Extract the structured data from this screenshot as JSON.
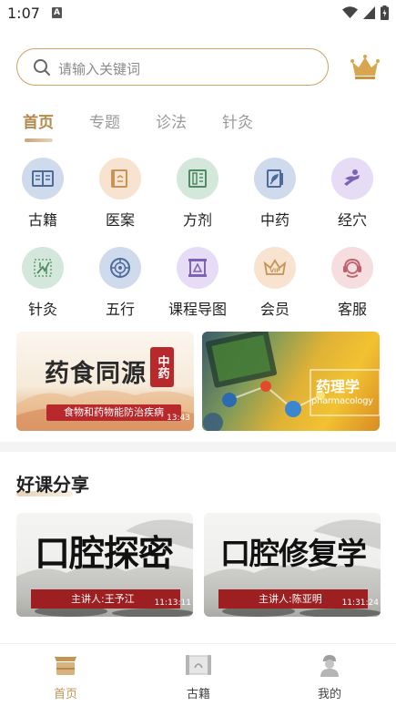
{
  "status_bar": {
    "time": "1:07",
    "notification_badge": "A"
  },
  "search": {
    "placeholder": "请输入关键词"
  },
  "tabs": [
    {
      "label": "首页",
      "active": true
    },
    {
      "label": "专题",
      "active": false
    },
    {
      "label": "诊法",
      "active": false
    },
    {
      "label": "针灸",
      "active": false
    }
  ],
  "grid": [
    {
      "label": "古籍",
      "icon": "book-icon",
      "bg": "#cfdbed",
      "fg": "#4c6a9a"
    },
    {
      "label": "医案",
      "icon": "scroll-icon",
      "bg": "#f7e3cf",
      "fg": "#c79357"
    },
    {
      "label": "方剂",
      "icon": "prescription-icon",
      "bg": "#d3e7da",
      "fg": "#4f8a63"
    },
    {
      "label": "中药",
      "icon": "herb-book-icon",
      "bg": "#cfdbed",
      "fg": "#4c6a9a"
    },
    {
      "label": "经穴",
      "icon": "acupoint-icon",
      "bg": "#e6dcf6",
      "fg": "#7d64b2"
    },
    {
      "label": "针灸",
      "icon": "needle-icon",
      "bg": "#d3e7da",
      "fg": "#4f8a63"
    },
    {
      "label": "五行",
      "icon": "five-elements-icon",
      "bg": "#cfdbed",
      "fg": "#4c6a9a"
    },
    {
      "label": "课程导图",
      "icon": "course-map-icon",
      "bg": "#e6dcf6",
      "fg": "#7d64b2"
    },
    {
      "label": "会员",
      "icon": "vip-crown-icon",
      "bg": "#f7e3cf",
      "fg": "#c79357"
    },
    {
      "label": "客服",
      "icon": "customer-service-icon",
      "bg": "#f6dde0",
      "fg": "#c0626e"
    }
  ],
  "banners": {
    "left": {
      "title": "药食同源",
      "seal": "中药",
      "subtitle": "食物和药物能防治疾病",
      "duration": "13:43"
    },
    "right": {
      "title": "药理学",
      "subtitle": "pharmacology"
    }
  },
  "section": {
    "title": "好课分享"
  },
  "courses": [
    {
      "title": "口腔探密",
      "lecturer": "主讲人:王予江",
      "duration": "11:13:11"
    },
    {
      "title": "口腔修复学",
      "lecturer": "主讲人:陈亚明",
      "duration": "11:31:24"
    }
  ],
  "bottom_nav": [
    {
      "label": "首页",
      "active": true
    },
    {
      "label": "古籍",
      "active": false
    },
    {
      "label": "我的",
      "active": false
    }
  ],
  "colors": {
    "accent": "#c19554",
    "search_border": "#d2a05f",
    "ribbon_red": "#9e1f22"
  }
}
